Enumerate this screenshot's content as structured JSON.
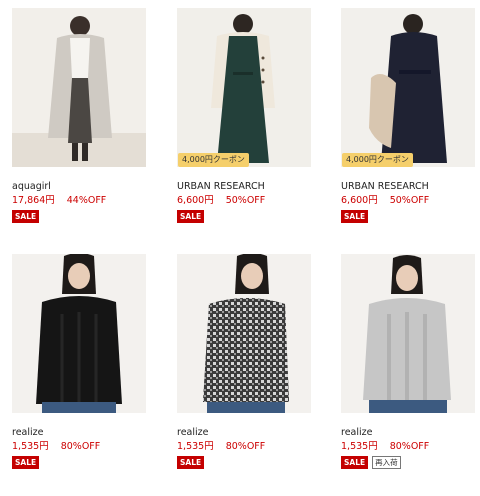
{
  "products": [
    {
      "image": "model in light gray long coat over white sweater",
      "coupon": "",
      "brand": "aquagirl",
      "price": "17,864円",
      "discount": "44%OFF",
      "badges": [
        "SALE"
      ]
    },
    {
      "image": "model in dark green dress with cream cardigan",
      "coupon": "4,000円クーポン",
      "brand": "URBAN RESEARCH",
      "price": "6,600円",
      "discount": "50%OFF",
      "badges": [
        "SALE"
      ]
    },
    {
      "image": "model in navy long dress holding beige coat",
      "coupon": "4,000円クーポン",
      "brand": "URBAN RESEARCH",
      "price": "6,600円",
      "discount": "50%OFF",
      "badges": [
        "SALE"
      ]
    },
    {
      "image": "model in black cable knit sweater with denim skirt",
      "coupon": "",
      "brand": "realize",
      "price": "1,535円",
      "discount": "80%OFF",
      "badges": [
        "SALE"
      ]
    },
    {
      "image": "model in black and white mixed knit sweater with denim skirt",
      "coupon": "",
      "brand": "realize",
      "price": "1,535円",
      "discount": "80%OFF",
      "badges": [
        "SALE"
      ]
    },
    {
      "image": "model in light gray cable knit sweater with denim skirt",
      "coupon": "",
      "brand": "realize",
      "price": "1,535円",
      "discount": "80%OFF",
      "badges": [
        "SALE",
        "再入荷"
      ]
    }
  ],
  "colors": {
    "price": "#cc0000",
    "sale_badge": "#c40000",
    "coupon_badge": "#f5cf6b",
    "photo_bg": "#f3f0ec"
  }
}
